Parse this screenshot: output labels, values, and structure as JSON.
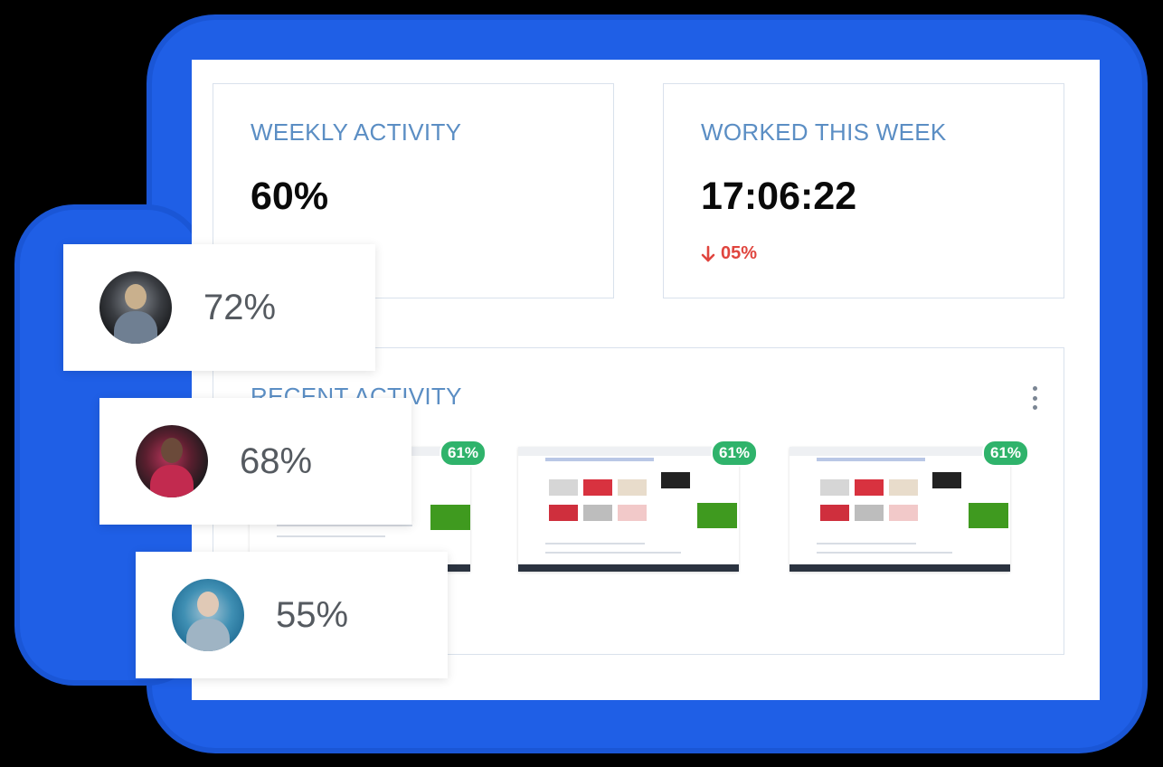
{
  "weekly_activity": {
    "title": "WEEKLY ACTIVITY",
    "value": "60%"
  },
  "worked_this_week": {
    "title": "WORKED THIS WEEK",
    "value": "17:06:22",
    "change": "05%",
    "change_direction": "down",
    "change_color": "#e0453e"
  },
  "recent_activity": {
    "title": "RECENT ACTIVITY",
    "menu_icon": "kebab-menu-icon",
    "screenshots": [
      {
        "badge": "61%"
      },
      {
        "badge": "61%"
      },
      {
        "badge": "61%"
      }
    ]
  },
  "users": [
    {
      "percent": "72%"
    },
    {
      "percent": "68%"
    },
    {
      "percent": "55%"
    }
  ],
  "colors": {
    "accent_blue": "#1f5fe6",
    "title_blue": "#5b8ec4",
    "badge_green": "#2fb36b",
    "down_red": "#e0453e"
  }
}
